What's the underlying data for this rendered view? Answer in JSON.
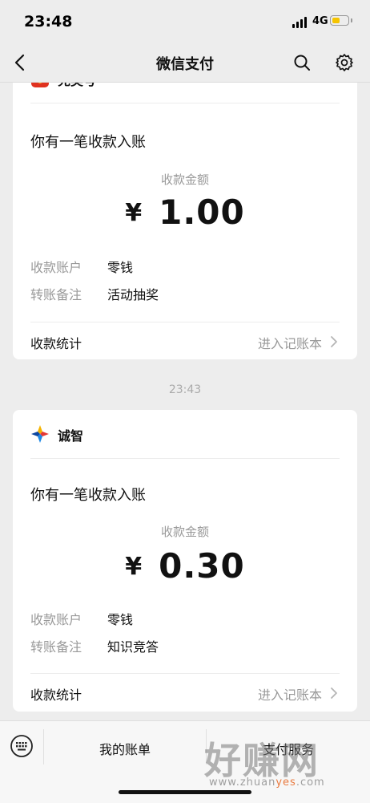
{
  "status_bar": {
    "time": "23:48",
    "network": "4G"
  },
  "nav": {
    "title": "微信支付"
  },
  "cards": [
    {
      "sender": "兑奖号",
      "message": "你有一笔收款入账",
      "amount_label": "收款金额",
      "currency": "¥",
      "amount": "1.00",
      "account_key": "收款账户",
      "account_value": "零钱",
      "note_key": "转账备注",
      "note_value": "活动抽奖",
      "stats_label": "收款统计",
      "ledger_link": "进入记账本"
    },
    {
      "sender": "诚智",
      "message": "你有一笔收款入账",
      "amount_label": "收款金额",
      "currency": "¥",
      "amount": "0.30",
      "account_key": "收款账户",
      "account_value": "零钱",
      "note_key": "转账备注",
      "note_value": "知识竞答",
      "stats_label": "收款统计",
      "ledger_link": "进入记账本"
    }
  ],
  "timestamp": "23:43",
  "bottom_bar": {
    "menu1": "我的账单",
    "menu2": "支付服务"
  },
  "watermark": {
    "big": "好赚网",
    "small_a": "www.zhuan",
    "small_b": "yes",
    "small_c": ".com"
  },
  "colors": {
    "background": "#ededed",
    "battery": "#f5c400",
    "muted": "#999999"
  }
}
